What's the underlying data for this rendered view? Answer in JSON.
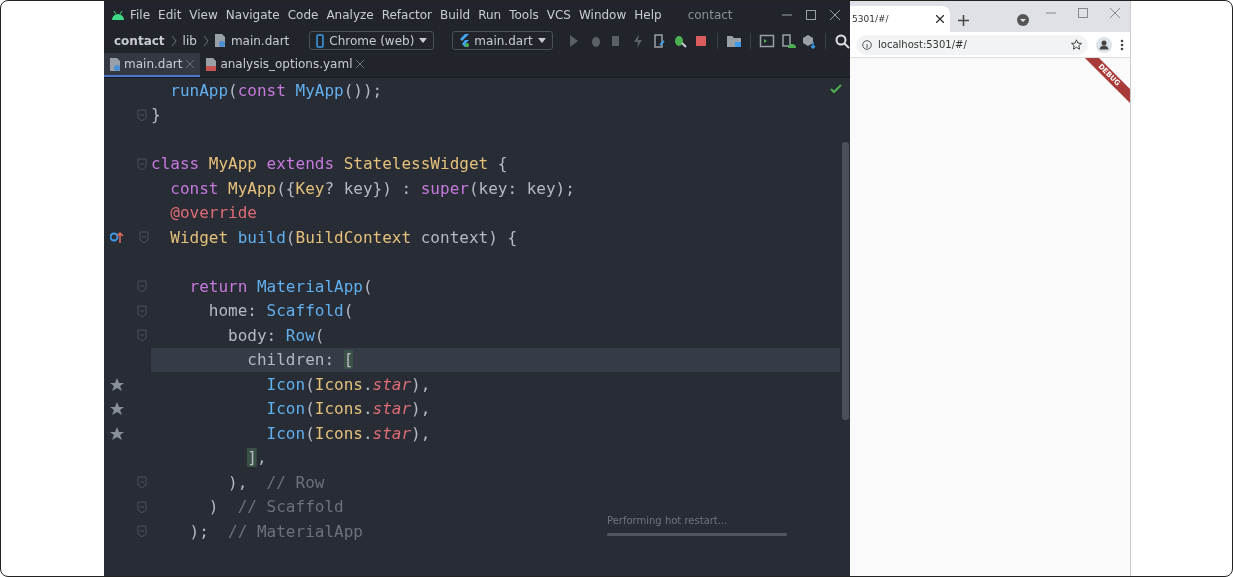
{
  "ide": {
    "menu": [
      "File",
      "Edit",
      "View",
      "Navigate",
      "Code",
      "Analyze",
      "Refactor",
      "Build",
      "Run",
      "Tools",
      "VCS",
      "Window",
      "Help"
    ],
    "title": "contact",
    "breadcrumbs": [
      "contact",
      "lib",
      "main.dart"
    ],
    "device": "Chrome (web)",
    "run_config": "main.dart",
    "tabs": [
      {
        "label": "main.dart",
        "selected": true,
        "kind": "dart"
      },
      {
        "label": "analysis_options.yaml",
        "selected": false,
        "kind": "yaml"
      }
    ],
    "code": [
      {
        "current": false,
        "tokens": [
          {
            "text": "  runApp",
            "kind": "f"
          },
          {
            "text": "(",
            "kind": "p"
          },
          {
            "text": "const",
            "kind": "k"
          },
          {
            "text": " MyApp",
            "kind": "f"
          },
          {
            "text": "());",
            "kind": "p"
          }
        ]
      },
      {
        "current": false,
        "gutter": [
          {
            "kind": "fold"
          }
        ],
        "tokens": [
          {
            "text": "}",
            "kind": "p"
          }
        ]
      },
      {
        "current": false
      },
      {
        "current": false,
        "gutter": [
          {
            "kind": "fold"
          }
        ],
        "tokens": [
          {
            "text": "class",
            "kind": "k"
          },
          {
            "text": " MyApp",
            "kind": "t"
          },
          {
            "text": " extends",
            "kind": "k"
          },
          {
            "text": " StatelessWidget",
            "kind": "t"
          },
          {
            "text": " {",
            "kind": "p"
          }
        ]
      },
      {
        "current": false,
        "tokens": [
          {
            "text": "  const",
            "kind": "k"
          },
          {
            "text": " MyApp",
            "kind": "t"
          },
          {
            "text": "({",
            "kind": "p"
          },
          {
            "text": "Key",
            "kind": "t"
          },
          {
            "text": "? key}) : ",
            "kind": "p"
          },
          {
            "text": "super",
            "kind": "k"
          },
          {
            "text": "(key: key);",
            "kind": "p"
          }
        ]
      },
      {
        "current": false,
        "tokens": [
          {
            "text": "  @override",
            "kind": "a"
          }
        ]
      },
      {
        "current": false,
        "gutter": [
          {
            "kind": "override"
          },
          {
            "kind": "fold"
          }
        ],
        "tokens": [
          {
            "text": "  Widget",
            "kind": "t"
          },
          {
            "text": " build",
            "kind": "f"
          },
          {
            "text": "(",
            "kind": "p"
          },
          {
            "text": "BuildContext",
            "kind": "t"
          },
          {
            "text": " context) {",
            "kind": "p"
          }
        ]
      },
      {
        "current": false
      },
      {
        "current": false,
        "gutter": [
          {
            "kind": "fold"
          }
        ],
        "tokens": [
          {
            "text": "    return",
            "kind": "k"
          },
          {
            "text": " MaterialApp",
            "kind": "f"
          },
          {
            "text": "(",
            "kind": "p"
          }
        ]
      },
      {
        "current": false,
        "gutter": [
          {
            "kind": "fold"
          }
        ],
        "tokens": [
          {
            "text": "      home: ",
            "kind": "p"
          },
          {
            "text": "Scaffold",
            "kind": "f"
          },
          {
            "text": "(",
            "kind": "p"
          }
        ]
      },
      {
        "current": false,
        "gutter": [
          {
            "kind": "fold"
          }
        ],
        "tokens": [
          {
            "text": "        body: ",
            "kind": "p"
          },
          {
            "text": "Row",
            "kind": "f"
          },
          {
            "text": "(",
            "kind": "p"
          }
        ]
      },
      {
        "current": true,
        "tokens": [
          {
            "text": "          children: ",
            "kind": "p"
          },
          {
            "text": "[",
            "kind": "m"
          }
        ]
      },
      {
        "current": false,
        "gutter": [
          {
            "kind": "star"
          }
        ],
        "tokens": [
          {
            "text": "            Icon",
            "kind": "f"
          },
          {
            "text": "(",
            "kind": "p"
          },
          {
            "text": "Icons",
            "kind": "t"
          },
          {
            "text": ".",
            "kind": "p"
          },
          {
            "text": "star",
            "kind": "s"
          },
          {
            "text": "),",
            "kind": "p"
          }
        ]
      },
      {
        "current": false,
        "gutter": [
          {
            "kind": "star"
          }
        ],
        "tokens": [
          {
            "text": "            Icon",
            "kind": "f"
          },
          {
            "text": "(",
            "kind": "p"
          },
          {
            "text": "Icons",
            "kind": "t"
          },
          {
            "text": ".",
            "kind": "p"
          },
          {
            "text": "star",
            "kind": "s"
          },
          {
            "text": "),",
            "kind": "p"
          }
        ]
      },
      {
        "current": false,
        "gutter": [
          {
            "kind": "star"
          }
        ],
        "tokens": [
          {
            "text": "            Icon",
            "kind": "f"
          },
          {
            "text": "(",
            "kind": "p"
          },
          {
            "text": "Icons",
            "kind": "t"
          },
          {
            "text": ".",
            "kind": "p"
          },
          {
            "text": "star",
            "kind": "s"
          },
          {
            "text": "),",
            "kind": "p"
          }
        ]
      },
      {
        "current": false,
        "tokens": [
          {
            "text": "          ]",
            "kind": "m"
          },
          {
            "text": ",",
            "kind": "p"
          }
        ]
      },
      {
        "current": false,
        "gutter": [
          {
            "kind": "fold"
          }
        ],
        "tokens": [
          {
            "text": "        ),  ",
            "kind": "p"
          },
          {
            "text": "// Row",
            "kind": "c"
          }
        ]
      },
      {
        "current": false,
        "gutter": [
          {
            "kind": "fold"
          }
        ],
        "tokens": [
          {
            "text": "      )  ",
            "kind": "p"
          },
          {
            "text": "// Scaffold",
            "kind": "c"
          }
        ]
      },
      {
        "current": false,
        "gutter": [
          {
            "kind": "fold"
          }
        ],
        "tokens": [
          {
            "text": "    );  ",
            "kind": "p"
          },
          {
            "text": "// MaterialApp",
            "kind": "c"
          }
        ]
      }
    ],
    "progress": {
      "label": "Performing hot restart...",
      "level": 1
    }
  },
  "browser": {
    "tab": {
      "label": "5301/#/",
      "selected": true
    },
    "url": "localhost:5301/#/",
    "banner": "DEBUG"
  }
}
